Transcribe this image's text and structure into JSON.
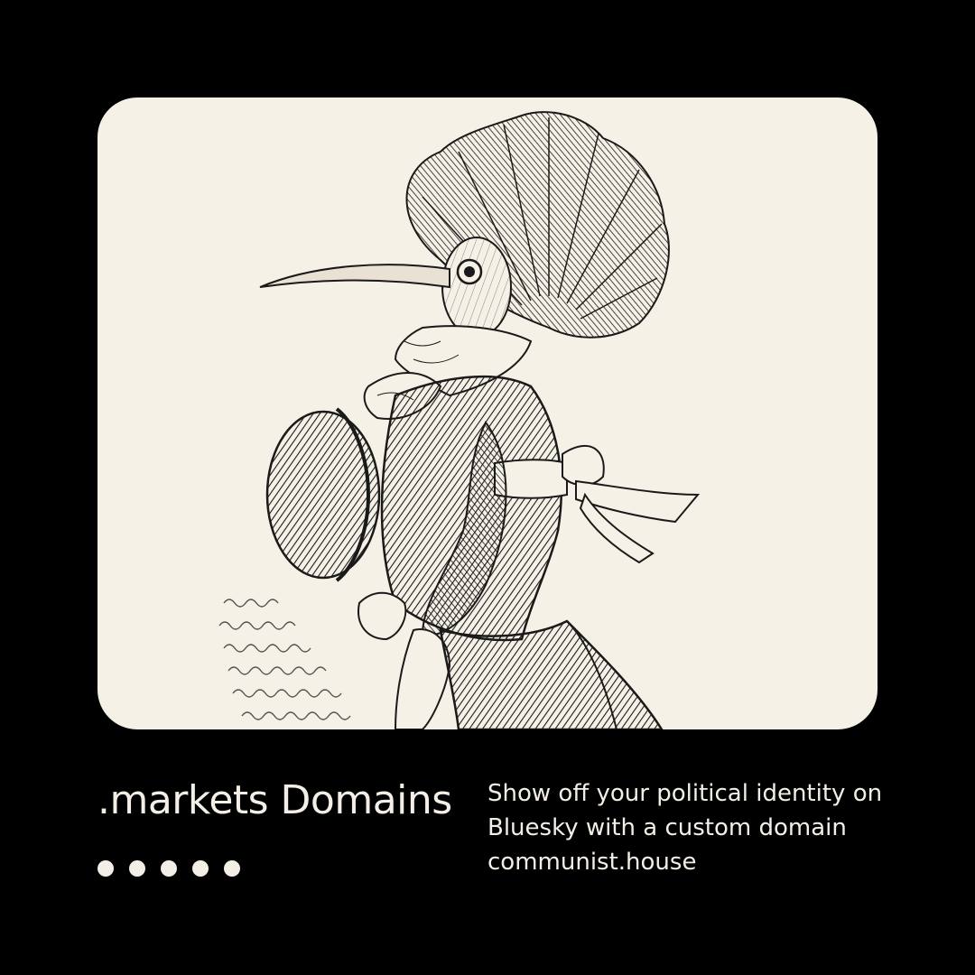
{
  "card": {
    "illustration_icon": "dandy-hoopoe-engraving-icon",
    "background_color": "#f6f1e7",
    "ink_color": "#1a1a1a"
  },
  "title": ".markets Domains",
  "carousel": {
    "dot_count": 5,
    "dot_color": "#f4efe6"
  },
  "description": {
    "lines": [
      "Show off your political identity on",
      "Bluesky with a custom domain",
      "communist.house"
    ]
  },
  "colors": {
    "page_background": "#000000",
    "text": "#f4efe6"
  }
}
